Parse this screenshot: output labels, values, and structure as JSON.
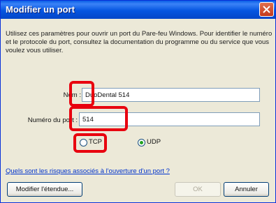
{
  "dialog": {
    "title": "Modifier un port",
    "description": "Utilisez ces paramètres pour ouvrir un port du Pare-feu Windows. Pour identifier le numéro et le protocole du port, consultez la documentation du programme ou du service que vous voulez vous utiliser.",
    "name_label": "Nom :",
    "name_value": "DuoDental 514",
    "port_label": "Numéro du port :",
    "port_value": "514",
    "protocol_tcp": "TCP",
    "protocol_udp": "UDP",
    "selected_protocol": "UDP",
    "risk_link": "Quels sont les risques associés à l'ouverture d'un port ?",
    "change_scope_button": "Modifier l'étendue...",
    "ok_button": "OK",
    "cancel_button": "Annuler"
  },
  "colors": {
    "highlight": "#e8000e",
    "titlebar": "#0555e0"
  },
  "icons": {
    "close": "close-icon"
  }
}
